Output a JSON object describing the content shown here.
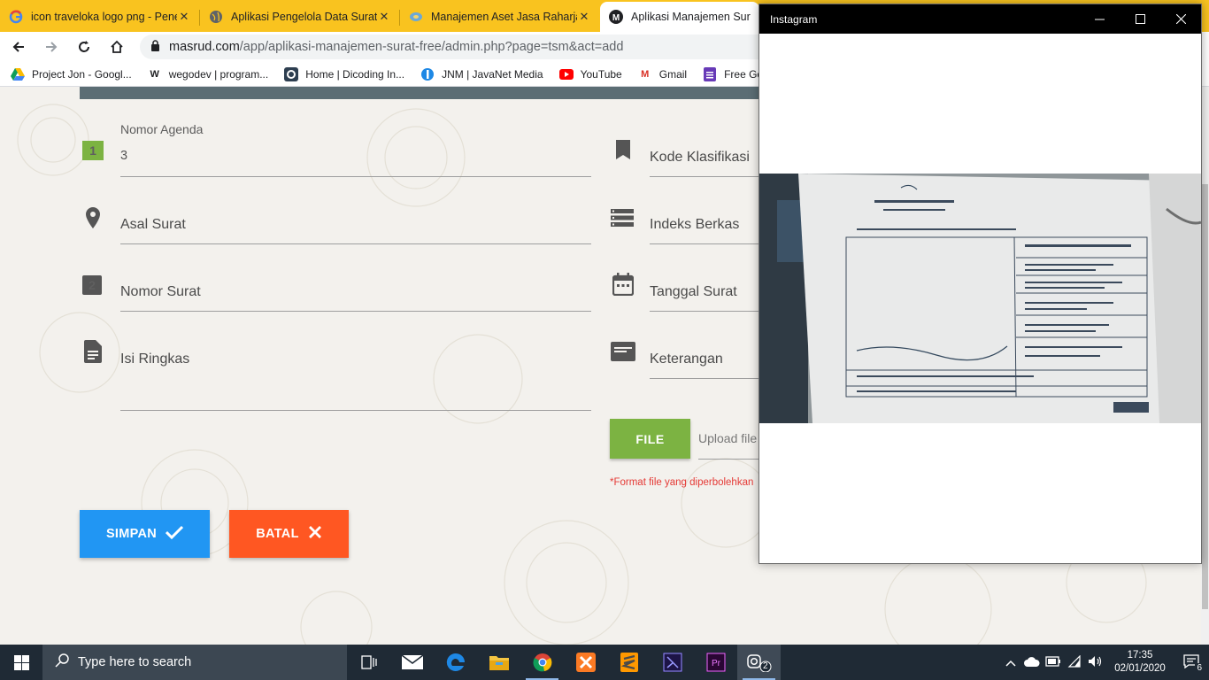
{
  "browser": {
    "tabs": [
      {
        "title": "icon traveloka logo png - Pene",
        "icon": "google-icon"
      },
      {
        "title": "Aplikasi Pengelola Data Surat",
        "icon": "globe-icon"
      },
      {
        "title": "Manajemen Aset Jasa Raharja",
        "icon": "jasa-raharja-icon"
      },
      {
        "title": "Aplikasi Manajemen Sura",
        "icon": "m-logo-icon",
        "active": true
      }
    ],
    "url_host": "masrud.com",
    "url_path": "/app/aplikasi-manajemen-surat-free/admin.php?page=tsm&act=add",
    "bookmarks": [
      {
        "label": "Project Jon - Googl...",
        "icon": "google-drive-icon"
      },
      {
        "label": "wegodev | program...",
        "icon": "wegodev-icon",
        "glyph": "W"
      },
      {
        "label": "Home | Dicoding In...",
        "icon": "dicoding-icon"
      },
      {
        "label": "JNM | JavaNet Media",
        "icon": "jnm-icon"
      },
      {
        "label": "YouTube",
        "icon": "youtube-icon"
      },
      {
        "label": "Gmail",
        "icon": "gmail-icon",
        "glyph": "M"
      },
      {
        "label": "Free Goo",
        "icon": "google-forms-icon"
      }
    ]
  },
  "form": {
    "nomor_agenda": {
      "label": "Nomor Agenda",
      "value": "3",
      "badge": "1"
    },
    "kode_klasifikasi": {
      "label": "Kode Klasifikasi"
    },
    "asal_surat": {
      "label": "Asal Surat"
    },
    "indeks_berkas": {
      "label": "Indeks Berkas"
    },
    "nomor_surat": {
      "label": "Nomor Surat",
      "badge": "2"
    },
    "tanggal_surat": {
      "label": "Tanggal Surat"
    },
    "isi_ringkas": {
      "label": "Isi Ringkas"
    },
    "keterangan": {
      "label": "Keterangan"
    },
    "file_button": "FILE",
    "upload_placeholder": "Upload file",
    "format_note": "*Format file yang diperbolehkan",
    "save_button": "SIMPAN",
    "cancel_button": "BATAL"
  },
  "instagram": {
    "title": "Instagram"
  },
  "taskbar": {
    "search_placeholder": "Type here to search",
    "time": "17:35",
    "date": "02/01/2020",
    "notification_count": "6",
    "instagram_badge": "2"
  },
  "colors": {
    "tab_bar": "#f9c31f",
    "green": "#7cb342",
    "blue": "#2196f3",
    "orange": "#ff5722",
    "error": "#e53935",
    "taskbar": "#1f2a35"
  }
}
